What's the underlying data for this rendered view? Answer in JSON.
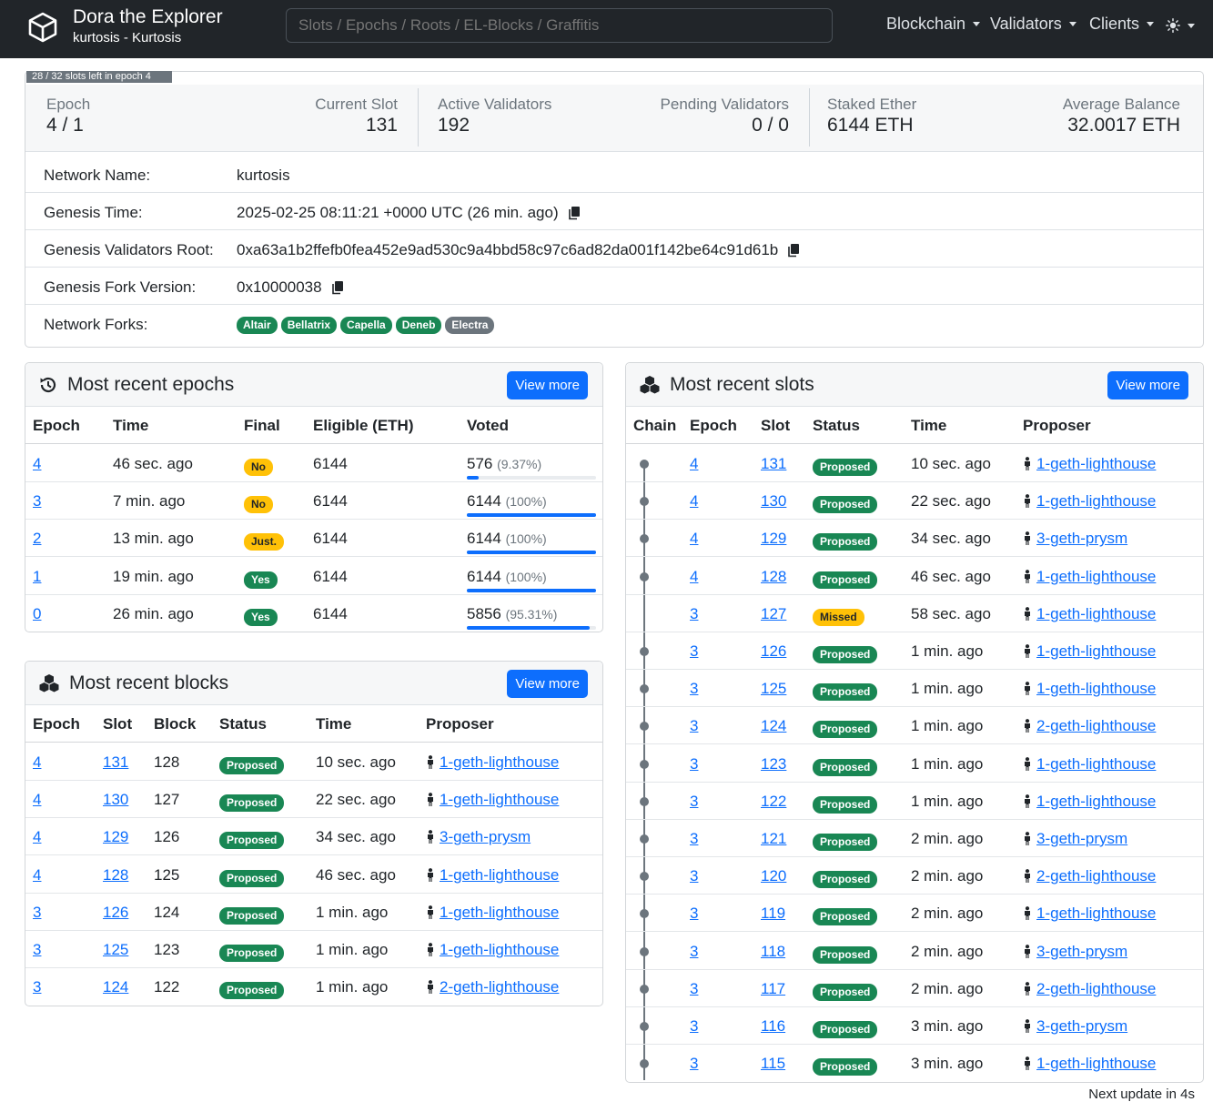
{
  "header": {
    "title": "Dora the Explorer",
    "subtitle": "kurtosis - Kurtosis",
    "search_placeholder": "Slots / Epochs / Roots / EL-Blocks / Graffitis",
    "menus": [
      "Blockchain",
      "Validators",
      "Clients"
    ],
    "theme_icon": "sun-icon"
  },
  "stats": {
    "epoch_progress": "28 / 32 slots left in epoch 4",
    "epoch_label": "Epoch",
    "epoch_value": "4 / 1",
    "slot_label": "Current Slot",
    "slot_value": "131",
    "active_label": "Active Validators",
    "active_value": "192",
    "pending_label": "Pending Validators",
    "pending_value": "0 / 0",
    "staked_label": "Staked Ether",
    "staked_value": "6144 ETH",
    "avg_label": "Average Balance",
    "avg_value": "32.0017 ETH"
  },
  "network": {
    "name_label": "Network Name:",
    "name_value": "kurtosis",
    "genesis_time_label": "Genesis Time:",
    "genesis_time_value": "2025-02-25 08:11:21 +0000 UTC (26 min. ago)",
    "root_label": "Genesis Validators Root:",
    "root_value": "0xa63a1b2ffefb0fea452e9ad530c9a4bbd58c97c6ad82da001f142be64c91d61b",
    "fork_version_label": "Genesis Fork Version:",
    "fork_version_value": "0x10000038",
    "forks_label": "Network Forks:",
    "forks": [
      {
        "name": "Altair",
        "color": "#198754"
      },
      {
        "name": "Bellatrix",
        "color": "#198754"
      },
      {
        "name": "Capella",
        "color": "#198754"
      },
      {
        "name": "Deneb",
        "color": "#198754"
      },
      {
        "name": "Electra",
        "color": "#6c757d"
      }
    ]
  },
  "epochs": {
    "title": "Most recent epochs",
    "view_more": "View more",
    "columns": [
      "Epoch",
      "Time",
      "Final",
      "Eligible (ETH)",
      "Voted"
    ],
    "rows": [
      {
        "epoch": "4",
        "time": "46 sec. ago",
        "final": "No",
        "final_color": "yellow",
        "eligible": "6144",
        "voted": "576",
        "pct": "(9.37%)",
        "fill": 0.0937
      },
      {
        "epoch": "3",
        "time": "7 min. ago",
        "final": "No",
        "final_color": "yellow",
        "eligible": "6144",
        "voted": "6144",
        "pct": "(100%)",
        "fill": 1.0
      },
      {
        "epoch": "2",
        "time": "13 min. ago",
        "final": "Just.",
        "final_color": "yellow",
        "eligible": "6144",
        "voted": "6144",
        "pct": "(100%)",
        "fill": 1.0
      },
      {
        "epoch": "1",
        "time": "19 min. ago",
        "final": "Yes",
        "final_color": "green",
        "eligible": "6144",
        "voted": "6144",
        "pct": "(100%)",
        "fill": 1.0
      },
      {
        "epoch": "0",
        "time": "26 min. ago",
        "final": "Yes",
        "final_color": "green",
        "eligible": "6144",
        "voted": "5856",
        "pct": "(95.31%)",
        "fill": 0.9531
      }
    ]
  },
  "blocks": {
    "title": "Most recent blocks",
    "view_more": "View more",
    "columns": [
      "Epoch",
      "Slot",
      "Block",
      "Status",
      "Time",
      "Proposer"
    ],
    "rows": [
      {
        "epoch": "4",
        "slot": "131",
        "block": "128",
        "status": "Proposed",
        "time": "10 sec. ago",
        "proposer": "1-geth-lighthouse"
      },
      {
        "epoch": "4",
        "slot": "130",
        "block": "127",
        "status": "Proposed",
        "time": "22 sec. ago",
        "proposer": "1-geth-lighthouse"
      },
      {
        "epoch": "4",
        "slot": "129",
        "block": "126",
        "status": "Proposed",
        "time": "34 sec. ago",
        "proposer": "3-geth-prysm"
      },
      {
        "epoch": "4",
        "slot": "128",
        "block": "125",
        "status": "Proposed",
        "time": "46 sec. ago",
        "proposer": "1-geth-lighthouse"
      },
      {
        "epoch": "3",
        "slot": "126",
        "block": "124",
        "status": "Proposed",
        "time": "1 min. ago",
        "proposer": "1-geth-lighthouse"
      },
      {
        "epoch": "3",
        "slot": "125",
        "block": "123",
        "status": "Proposed",
        "time": "1 min. ago",
        "proposer": "1-geth-lighthouse"
      },
      {
        "epoch": "3",
        "slot": "124",
        "block": "122",
        "status": "Proposed",
        "time": "1 min. ago",
        "proposer": "2-geth-lighthouse"
      }
    ]
  },
  "slots": {
    "title": "Most recent slots",
    "view_more": "View more",
    "columns": [
      "Chain",
      "Epoch",
      "Slot",
      "Status",
      "Time",
      "Proposer"
    ],
    "rows": [
      {
        "chain": true,
        "epoch": "4",
        "slot": "131",
        "status": "Proposed",
        "time": "10 sec. ago",
        "proposer": "1-geth-lighthouse"
      },
      {
        "chain": true,
        "epoch": "4",
        "slot": "130",
        "status": "Proposed",
        "time": "22 sec. ago",
        "proposer": "1-geth-lighthouse"
      },
      {
        "chain": true,
        "epoch": "4",
        "slot": "129",
        "status": "Proposed",
        "time": "34 sec. ago",
        "proposer": "3-geth-prysm"
      },
      {
        "chain": true,
        "epoch": "4",
        "slot": "128",
        "status": "Proposed",
        "time": "46 sec. ago",
        "proposer": "1-geth-lighthouse"
      },
      {
        "chain": false,
        "epoch": "3",
        "slot": "127",
        "status": "Missed",
        "time": "58 sec. ago",
        "proposer": "1-geth-lighthouse"
      },
      {
        "chain": true,
        "epoch": "3",
        "slot": "126",
        "status": "Proposed",
        "time": "1 min. ago",
        "proposer": "1-geth-lighthouse"
      },
      {
        "chain": true,
        "epoch": "3",
        "slot": "125",
        "status": "Proposed",
        "time": "1 min. ago",
        "proposer": "1-geth-lighthouse"
      },
      {
        "chain": true,
        "epoch": "3",
        "slot": "124",
        "status": "Proposed",
        "time": "1 min. ago",
        "proposer": "2-geth-lighthouse"
      },
      {
        "chain": true,
        "epoch": "3",
        "slot": "123",
        "status": "Proposed",
        "time": "1 min. ago",
        "proposer": "1-geth-lighthouse"
      },
      {
        "chain": true,
        "epoch": "3",
        "slot": "122",
        "status": "Proposed",
        "time": "1 min. ago",
        "proposer": "1-geth-lighthouse"
      },
      {
        "chain": true,
        "epoch": "3",
        "slot": "121",
        "status": "Proposed",
        "time": "2 min. ago",
        "proposer": "3-geth-prysm"
      },
      {
        "chain": true,
        "epoch": "3",
        "slot": "120",
        "status": "Proposed",
        "time": "2 min. ago",
        "proposer": "2-geth-lighthouse"
      },
      {
        "chain": true,
        "epoch": "3",
        "slot": "119",
        "status": "Proposed",
        "time": "2 min. ago",
        "proposer": "1-geth-lighthouse"
      },
      {
        "chain": true,
        "epoch": "3",
        "slot": "118",
        "status": "Proposed",
        "time": "2 min. ago",
        "proposer": "3-geth-prysm"
      },
      {
        "chain": true,
        "epoch": "3",
        "slot": "117",
        "status": "Proposed",
        "time": "2 min. ago",
        "proposer": "2-geth-lighthouse"
      },
      {
        "chain": true,
        "epoch": "3",
        "slot": "116",
        "status": "Proposed",
        "time": "3 min. ago",
        "proposer": "3-geth-prysm"
      },
      {
        "chain": true,
        "epoch": "3",
        "slot": "115",
        "status": "Proposed",
        "time": "3 min. ago",
        "proposer": "1-geth-lighthouse"
      }
    ]
  },
  "footer": {
    "next_update": "Next update in 4s"
  }
}
